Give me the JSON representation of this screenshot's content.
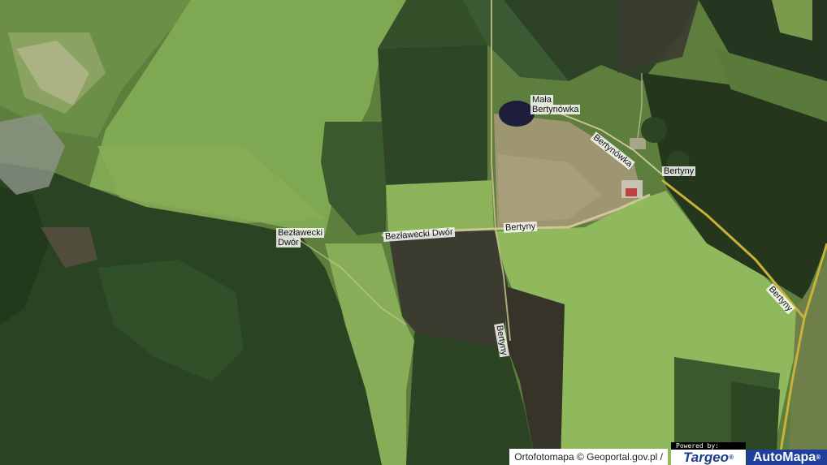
{
  "map": {
    "type": "aerial orthophoto",
    "colors": {
      "forest": "#26401f",
      "meadow": "#7aa34e",
      "dark_field": "#2f4424",
      "plowed_field": "#3a3a2c",
      "bare_soil": "#a8a078",
      "road": "#d8cfa0",
      "main_road_outline": "#c8b23a",
      "water": "#1e1e3a"
    }
  },
  "labels": {
    "mala_bertynowka": [
      "Mała",
      "Bertynówka"
    ],
    "bezlawecki_dwor_place": [
      "Bezławecki",
      "Dwór"
    ],
    "bezlawecki_dwor_road": "Bezławecki Dwór",
    "bertyny_road_center": "Bertyny",
    "bertynowka_road": "Bertynówka",
    "bertyny_village": "Bertyny",
    "bertyny_road_south": "Bertyny",
    "bertyny_road_east": "Bertyny"
  },
  "attribution": {
    "text": "Ortofotomapa © Geoportal.gov.pl",
    "separator": "/",
    "powered_by": "Powered by:",
    "targeo": "Targeo",
    "automapa": "AutoMapa",
    "registered": "®"
  }
}
